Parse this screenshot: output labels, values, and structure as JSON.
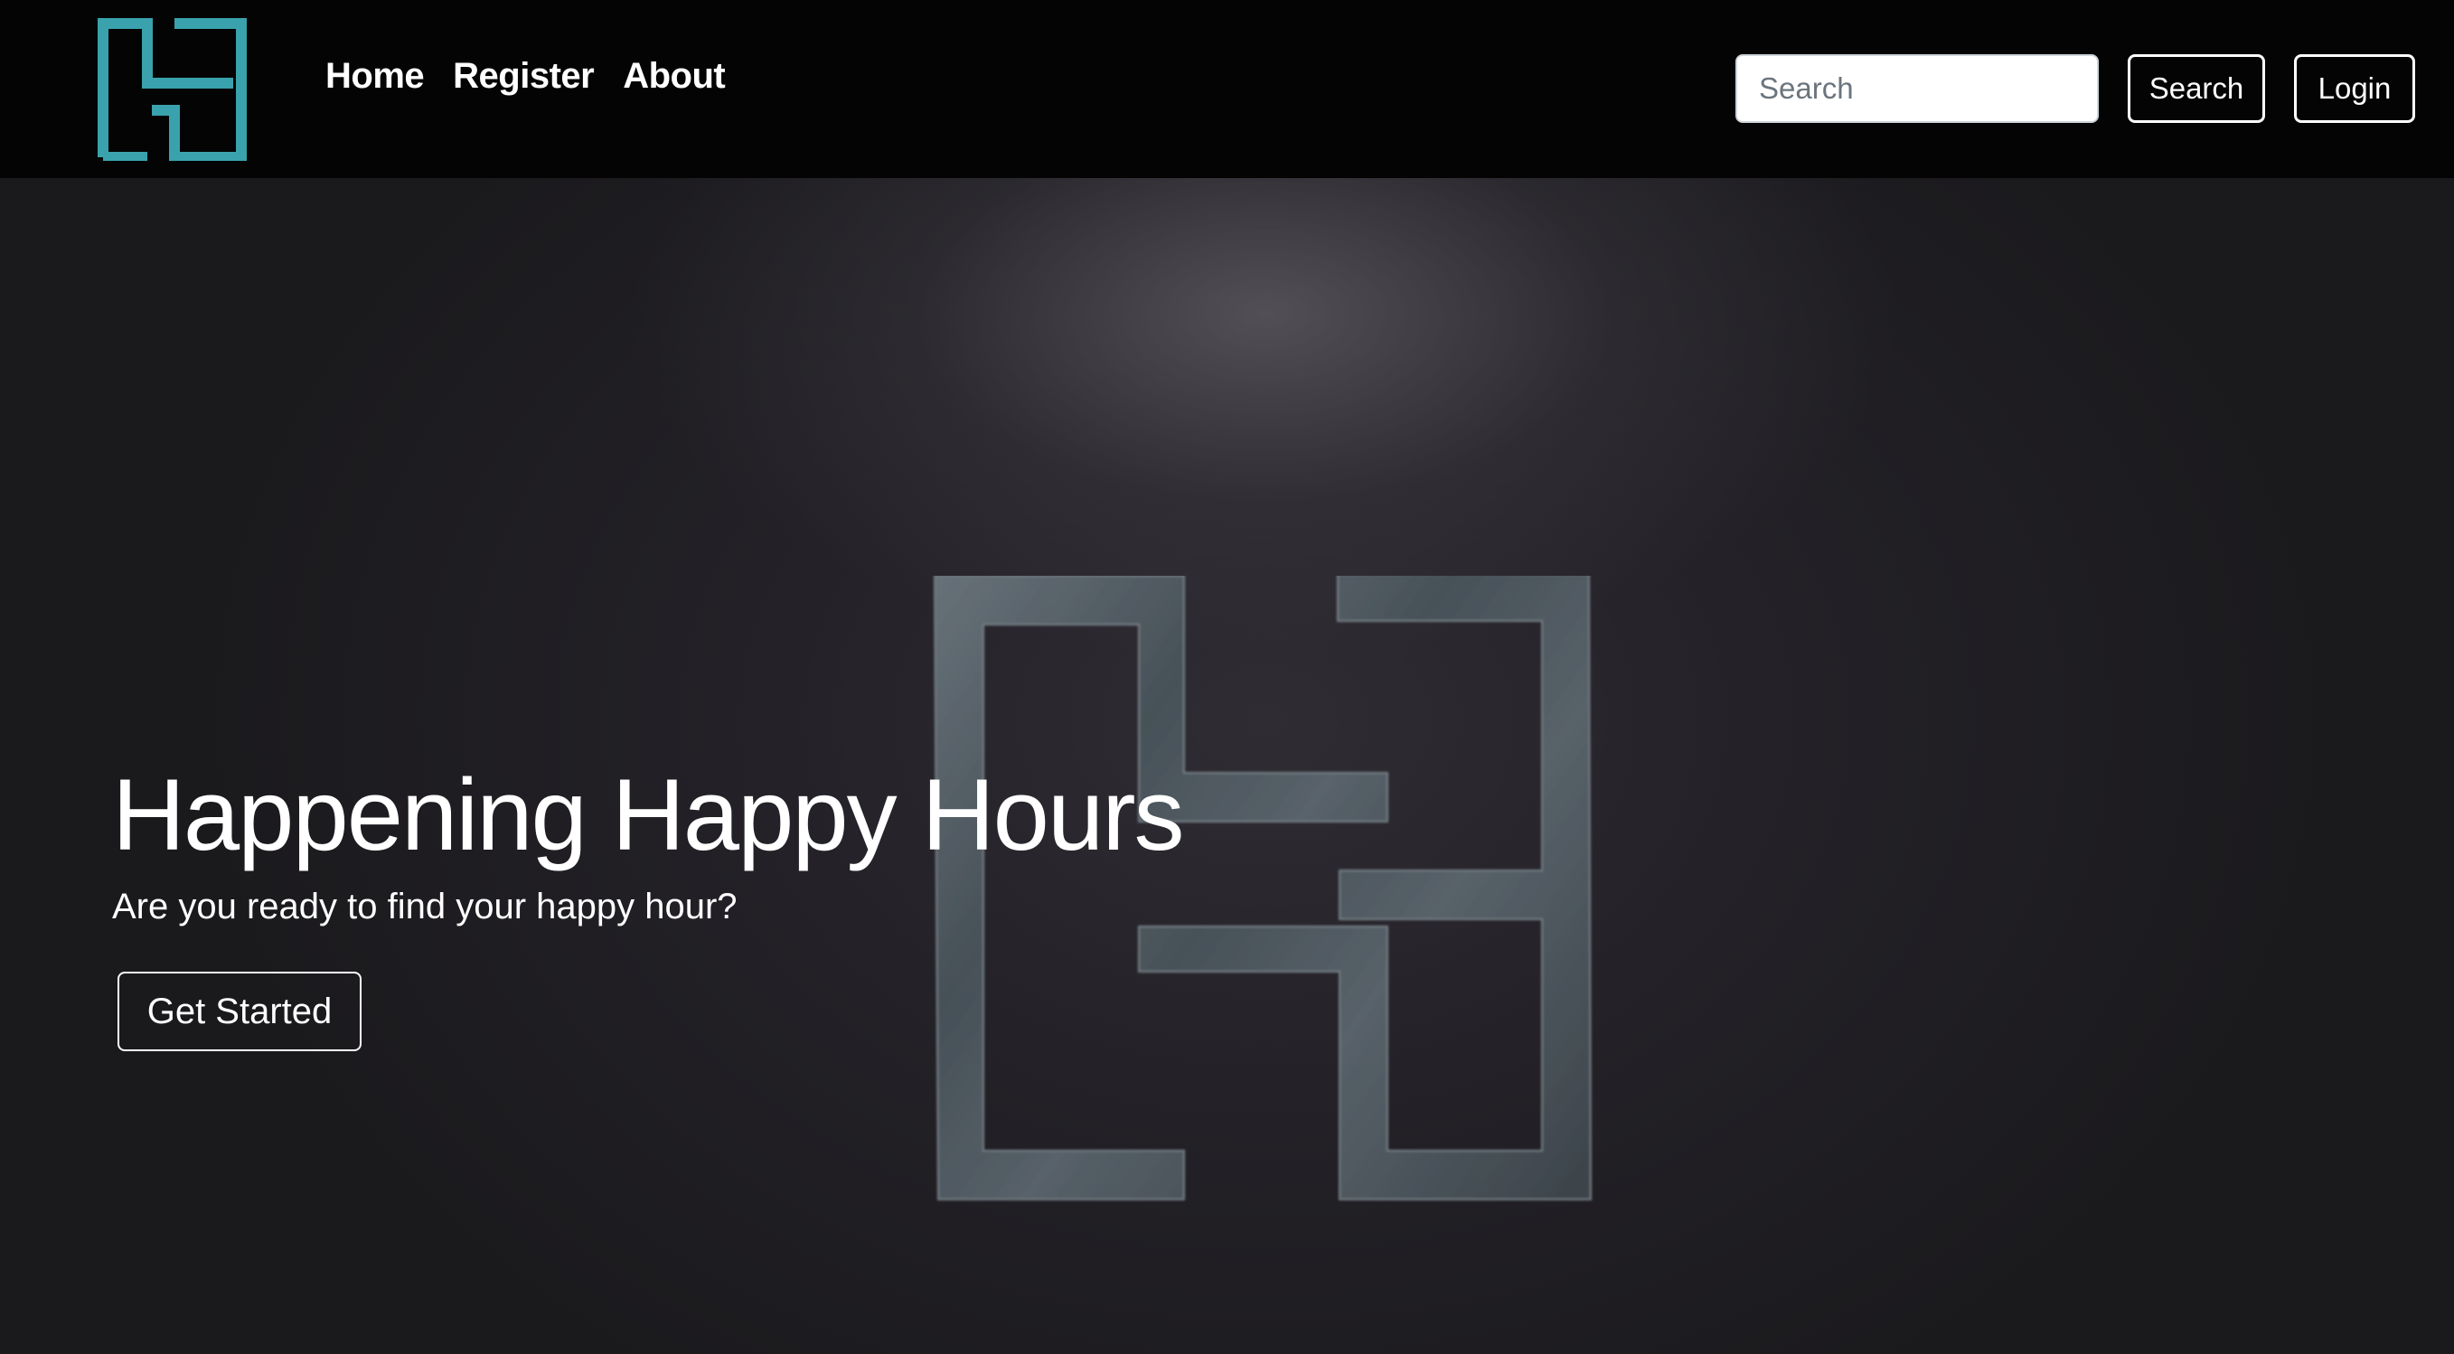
{
  "navbar": {
    "brand_icon": "hh-logo-icon",
    "links": [
      {
        "label": "Home"
      },
      {
        "label": "Register"
      },
      {
        "label": "About"
      }
    ],
    "search": {
      "placeholder": "Search",
      "value": "",
      "button_label": "Search"
    },
    "login_label": "Login"
  },
  "hero": {
    "background_icon": "hh-logo-icon",
    "title": "Happening Happy Hours",
    "subtitle": "Are you ready to find your happy hour?",
    "cta_label": "Get Started"
  },
  "colors": {
    "navbar_bg": "#040404",
    "brand_teal": "#39a2ad",
    "hero_bg": "#1a191c",
    "text": "#ffffff"
  }
}
